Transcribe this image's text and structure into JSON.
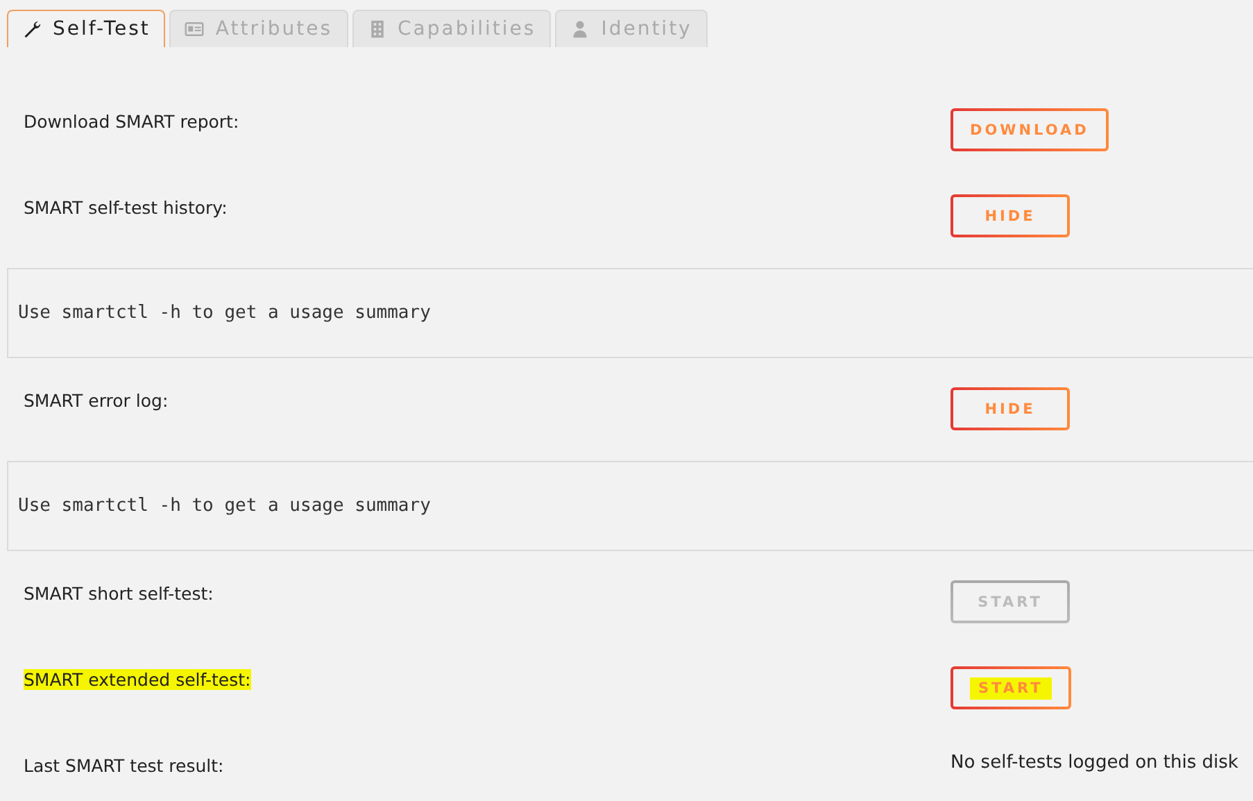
{
  "tabs": [
    {
      "label": "Self-Test",
      "kind": "wrench",
      "selected": true
    },
    {
      "label": "Attributes",
      "kind": "card",
      "selected": false
    },
    {
      "label": "Capabilities",
      "kind": "building",
      "selected": false
    },
    {
      "label": "Identity",
      "kind": "person",
      "selected": false
    }
  ],
  "rows": [
    {
      "kind": "action",
      "label": "Download SMART report:",
      "label_highlighted": false,
      "button": {
        "label": "DOWNLOAD",
        "disabled": false,
        "highlighted": false
      }
    },
    {
      "kind": "action",
      "label": "SMART self-test history:",
      "label_highlighted": false,
      "button": {
        "label": "HIDE",
        "disabled": false,
        "highlighted": false
      }
    },
    {
      "kind": "output",
      "text": "Use smartctl -h to get a usage summary"
    },
    {
      "kind": "action",
      "label": "SMART error log:",
      "label_highlighted": false,
      "button": {
        "label": "HIDE",
        "disabled": false,
        "highlighted": false
      }
    },
    {
      "kind": "output",
      "text": "Use smartctl -h to get a usage summary"
    },
    {
      "kind": "action",
      "label": "SMART short self-test:",
      "label_highlighted": false,
      "button": {
        "label": "START",
        "disabled": true,
        "highlighted": false
      }
    },
    {
      "kind": "action",
      "label": "SMART extended self-test:",
      "label_highlighted": true,
      "button": {
        "label": "START",
        "disabled": false,
        "highlighted": true
      }
    },
    {
      "kind": "result",
      "label": "Last SMART test result:",
      "value": "No self-tests logged on this disk"
    }
  ]
}
